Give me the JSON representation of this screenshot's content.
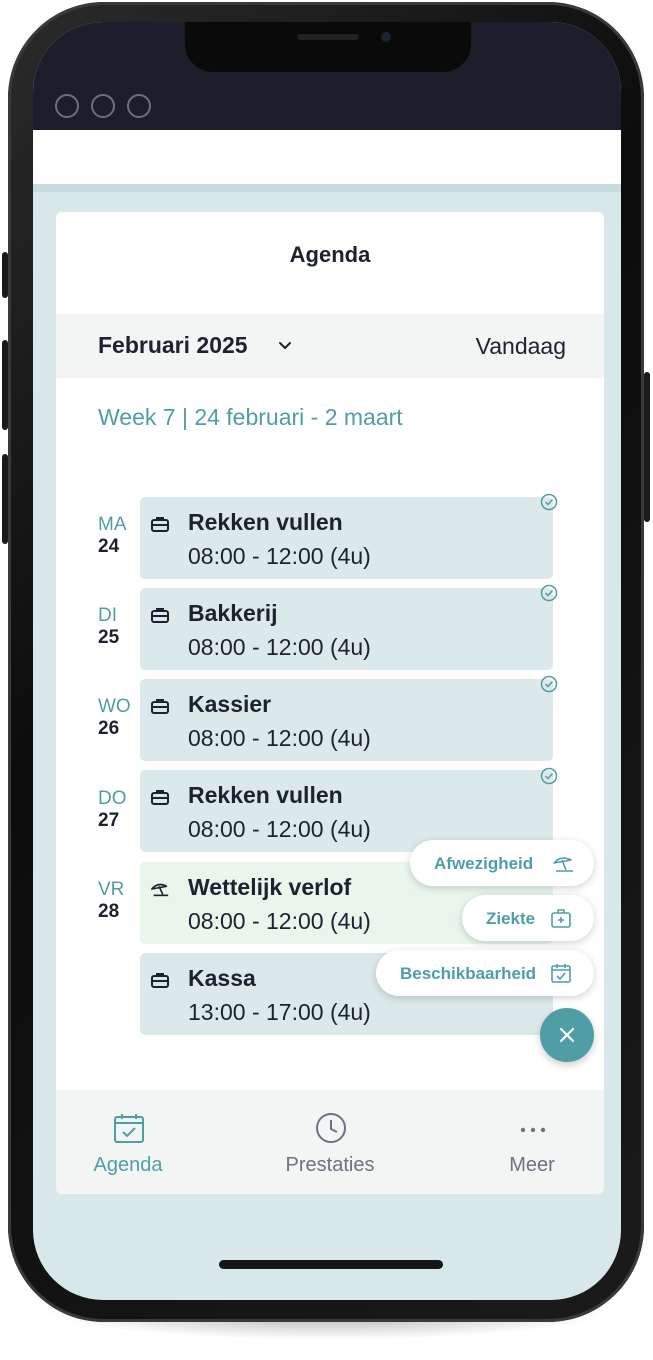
{
  "header": {
    "title": "Agenda"
  },
  "month_bar": {
    "month": "Februari 2025",
    "today_label": "Vandaag"
  },
  "week_label": "Week 7 | 24 februari - 2 maart",
  "days": [
    {
      "abbr": "MA",
      "num": "24"
    },
    {
      "abbr": "DI",
      "num": "25"
    },
    {
      "abbr": "WO",
      "num": "26"
    },
    {
      "abbr": "DO",
      "num": "27"
    },
    {
      "abbr": "VR",
      "num": "28"
    }
  ],
  "shifts": [
    {
      "name": "Rekken vullen",
      "time": "08:00 - 12:00 (4u)",
      "icon": "briefcase-icon",
      "confirmed": true
    },
    {
      "name": "Bakkerij",
      "time": "08:00 - 12:00 (4u)",
      "icon": "briefcase-icon",
      "confirmed": true
    },
    {
      "name": "Kassier",
      "time": "08:00 - 12:00 (4u)",
      "icon": "briefcase-icon",
      "confirmed": true
    },
    {
      "name": "Rekken vullen",
      "time": "08:00 - 12:00 (4u)",
      "icon": "briefcase-icon",
      "confirmed": true
    },
    {
      "name": "Wettelijk verlof",
      "time": "08:00 - 12:00 (4u)",
      "icon": "beach-umbrella-icon",
      "confirmed": false
    },
    {
      "name": "Kassa",
      "time": "13:00 - 17:00 (4u)",
      "icon": "briefcase-icon",
      "confirmed": false
    }
  ],
  "fab_menu": {
    "absence_label": "Afwezigheid",
    "sickness_label": "Ziekte",
    "availability_label": "Beschikbaarheid"
  },
  "bottom_nav": {
    "agenda_label": "Agenda",
    "prestaties_label": "Prestaties",
    "meer_label": "Meer"
  },
  "colors": {
    "accent": "#4f9ea6",
    "shift_bg": "#dbe9ea",
    "leave_bg": "#e8f6ec",
    "text": "#1d2130",
    "statusbar": "#1c1f2b"
  }
}
